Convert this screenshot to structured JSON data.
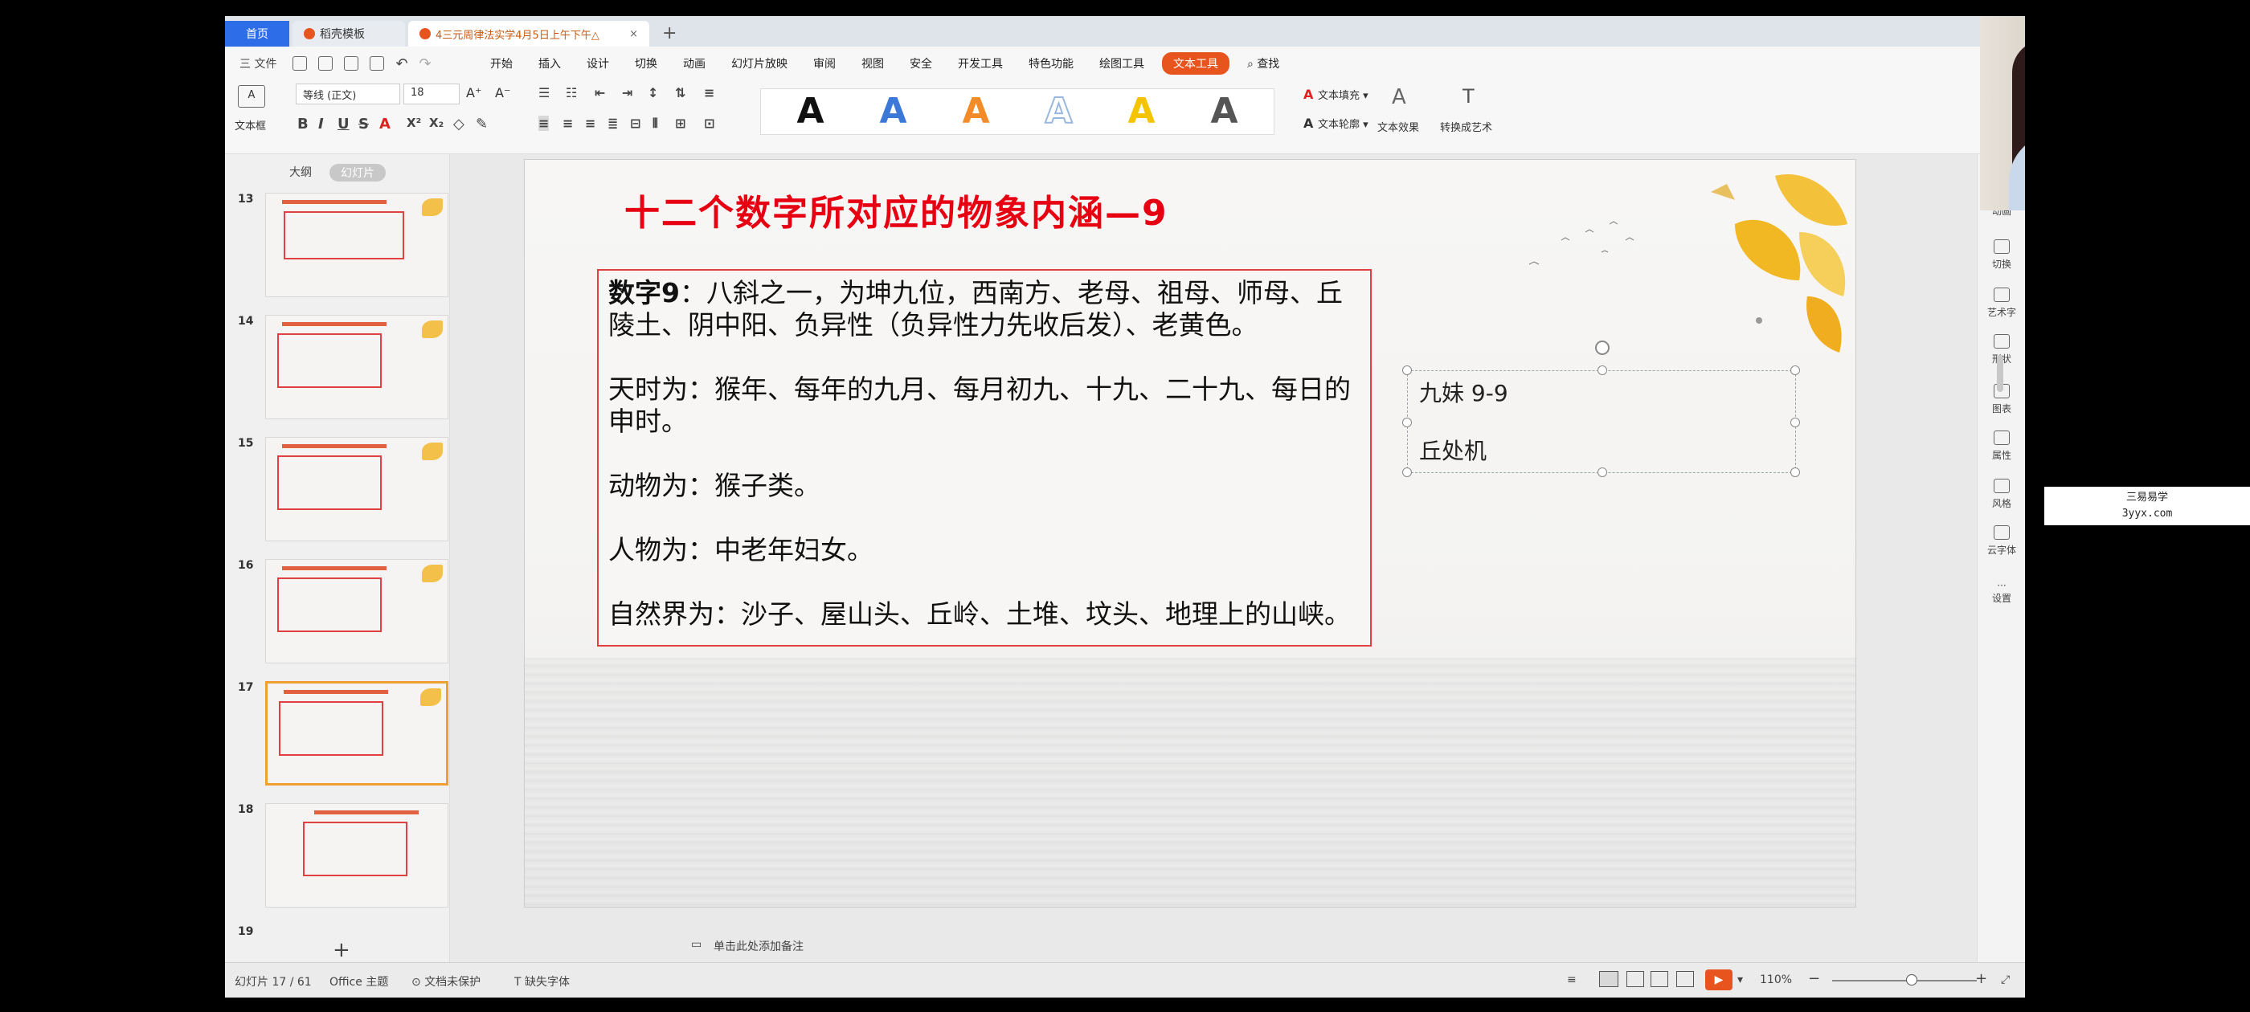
{
  "tabs": {
    "home": "首页",
    "templates": "稻壳模板",
    "document": "4三元周律法实学4月5日上午下午△",
    "close": "×",
    "new_tab": "+"
  },
  "menubar": {
    "file": "三 文件",
    "items": [
      "开始",
      "插入",
      "设计",
      "切换",
      "动画",
      "幻灯片放映",
      "审阅",
      "视图",
      "安全",
      "开发工具",
      "特色功能",
      "绘图工具",
      "文本工具"
    ],
    "search": "查找"
  },
  "ribbon": {
    "text_box": "文本框",
    "font_name": "等线 (正文)",
    "font_size": "18",
    "font_grow": "A⁺",
    "font_shrink": "A⁻",
    "text_fill": "文本填充",
    "text_outline": "文本轮廓",
    "text_effect": "文本效果",
    "convert_art": "转换成艺术",
    "style_colors": [
      "#111111",
      "#3b78d8",
      "#f28c28",
      "#9ab7e0",
      "#f5c400",
      "#555555"
    ]
  },
  "left_panel": {
    "tab_outline": "大纲",
    "tab_slides": "幻灯片",
    "slide_numbers": [
      "13",
      "14",
      "15",
      "16",
      "17",
      "18",
      "19"
    ],
    "current_slide": "17",
    "add": "+"
  },
  "slide": {
    "title": "十二个数字所对应的物象内涵—9",
    "paragraphs": [
      {
        "bold": "数字9",
        "text": "：八斜之一，为坤九位，西南方、老母、祖母、师母、丘陵土、阴中阳、负异性（负异性力先收后发）、老黄色。"
      },
      {
        "bold": "",
        "text": "天时为：猴年、每年的九月、每月初九、十九、二十九、每日的申时。"
      },
      {
        "bold": "",
        "text": "动物为：猴子类。"
      },
      {
        "bold": "",
        "text": "人物为：中老年妇女。"
      },
      {
        "bold": "",
        "text": "自然界为：沙子、屋山头、丘岭、土堆、坟头、地理上的山峡。"
      }
    ],
    "note_line1": "九妹 9-9",
    "note_line2": "丘处机"
  },
  "right_bar": [
    "动画",
    "切换",
    "艺术字",
    "形状",
    "图表",
    "属性",
    "风格",
    "云字体",
    "设置"
  ],
  "notes_bar": {
    "placeholder": "单击此处添加备注"
  },
  "status": {
    "slide_pos": "幻灯片 17 / 61",
    "theme": "Office 主题",
    "protect": "文档未保护",
    "missing_font": "缺失字体",
    "zoom": "110%",
    "zoom_level": 0.55
  },
  "watermark": {
    "line1": "三易易学",
    "line2": "3yyx.com"
  }
}
